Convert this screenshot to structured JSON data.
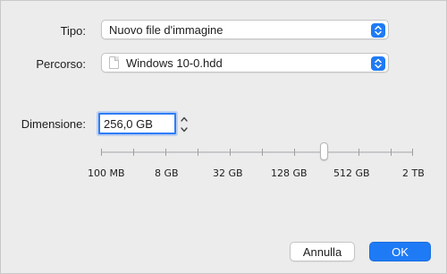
{
  "form": {
    "type_label": "Tipo:",
    "type_value": "Nuovo file d'immagine",
    "path_label": "Percorso:",
    "path_value": "Windows 10-0.hdd",
    "size_label": "Dimensione:",
    "size_value": "256,0 GB"
  },
  "slider": {
    "ticks": [
      "100 MB",
      "8  GB",
      "32  GB",
      "128  GB",
      "512  GB",
      "2 TB"
    ],
    "value": "256,0 GB"
  },
  "buttons": {
    "cancel": "Annulla",
    "ok": "OK"
  },
  "colors": {
    "accent": "#1f7bf5",
    "window_bg": "#ececec"
  },
  "icons": {
    "popup_arrows": "up-down-chevron-icon",
    "file": "document-icon",
    "stepper": "stepper-icon"
  }
}
